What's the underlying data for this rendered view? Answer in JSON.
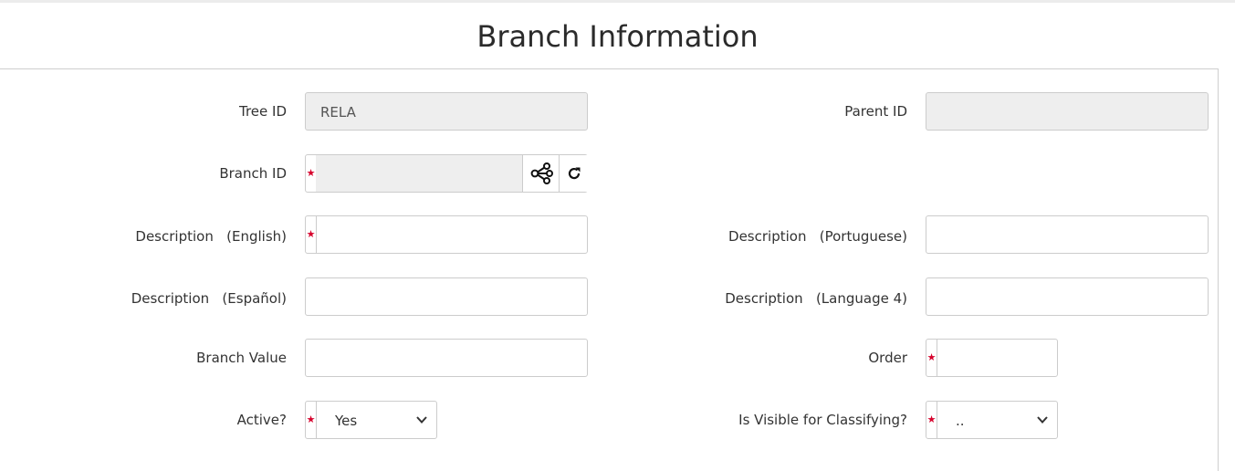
{
  "page": {
    "title": "Branch Information"
  },
  "form": {
    "tree_id": {
      "label": "Tree ID",
      "value": "RELA"
    },
    "parent_id": {
      "label": "Parent ID",
      "value": ""
    },
    "branch_id": {
      "label": "Branch ID",
      "value": "",
      "required": true
    },
    "desc_english": {
      "label": "Description   (English)",
      "value": "",
      "required": true
    },
    "desc_portuguese": {
      "label": "Description   (Portuguese)",
      "value": ""
    },
    "desc_espanol": {
      "label": "Description   (Español)",
      "value": ""
    },
    "desc_lang4": {
      "label": "Description   (Language 4)",
      "value": ""
    },
    "branch_value": {
      "label": "Branch Value",
      "value": ""
    },
    "order": {
      "label": "Order",
      "value": "",
      "required": true
    },
    "active": {
      "label": "Active?",
      "value": "Yes",
      "required": true
    },
    "visible_classifying": {
      "label": "Is Visible for Classifying?",
      "value": "..",
      "required": true
    }
  },
  "icons": {
    "tree": "share-tree-icon",
    "refresh": "refresh-icon",
    "required": "required-star-icon",
    "dropdown": "chevron-down-icon"
  },
  "colors": {
    "required_star": "#d6002b",
    "readonly_bg": "#eeeeee",
    "border": "#cccccc"
  }
}
